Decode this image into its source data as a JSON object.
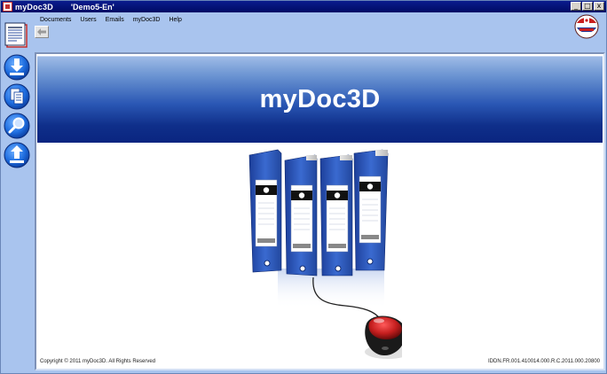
{
  "window": {
    "app_title": "myDoc3D",
    "document_title": "'Demo5-En'",
    "controls": {
      "minimize": "_",
      "maximize": "□",
      "close": "x"
    }
  },
  "menu": {
    "items": [
      {
        "label": "Documents"
      },
      {
        "label": "Users"
      },
      {
        "label": "Emails"
      },
      {
        "label": "myDoc3D"
      },
      {
        "label": "Help"
      }
    ]
  },
  "toolbar": {
    "back_icon": "arrow-left-icon",
    "side_buttons": [
      {
        "icon": "download-icon"
      },
      {
        "icon": "documents-icon"
      },
      {
        "icon": "search-icon"
      },
      {
        "icon": "upload-icon"
      }
    ]
  },
  "content": {
    "banner_title": "myDoc3D",
    "copyright": "Copyright © 2011 myDoc3D. All Rights Reserved",
    "registration": "IDDN.FR.001.410014.000.R.C.2011.000.20800"
  },
  "colors": {
    "window_bg": "#a9c4ee",
    "titlebar": "#0a1c8e",
    "banner_dark": "#0a2580",
    "banner_light": "#9ebbe6",
    "binder_blue": "#2a56b8",
    "mouse_red": "#c41e1e"
  }
}
